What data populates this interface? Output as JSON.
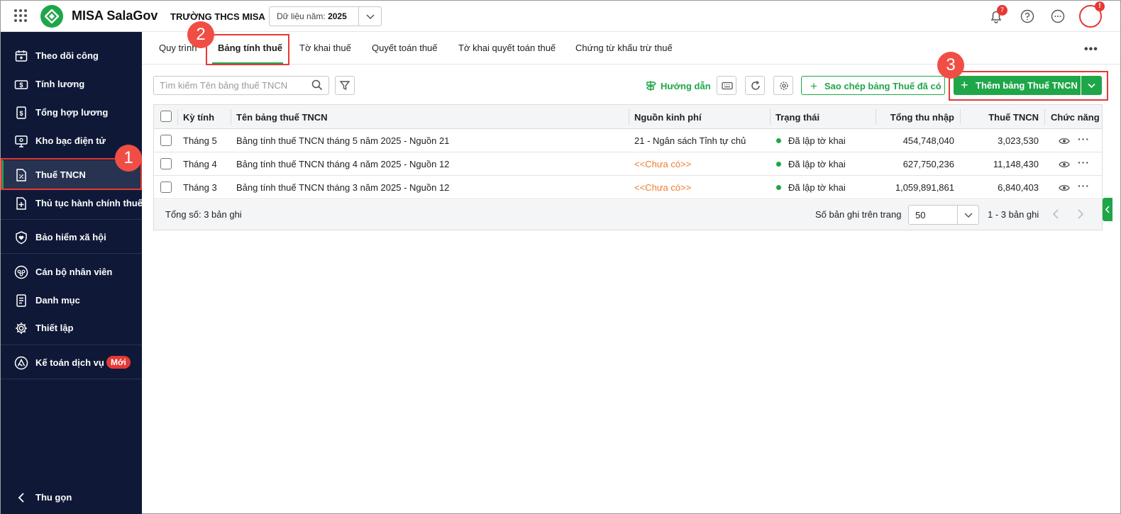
{
  "app": {
    "name": "MISA SalaGov",
    "org": "TRƯỜNG THCS MISA",
    "year_label": "Dữ liệu năm:",
    "year_value": "2025",
    "notification_count": "7",
    "avatar_alert": "!"
  },
  "sidebar": {
    "items": [
      {
        "label": "Theo dõi công",
        "icon": "calendar-icon"
      },
      {
        "label": "Tính lương",
        "icon": "money-icon"
      },
      {
        "label": "Tổng hợp lương",
        "icon": "salary-summary-icon"
      },
      {
        "label": "Kho bạc điện tử",
        "icon": "treasury-icon"
      },
      {
        "label": "Thuế TNCN",
        "icon": "tax-icon"
      },
      {
        "label": "Thủ tục hành chính thuế",
        "icon": "tax-procedure-icon"
      },
      {
        "label": "Bảo hiểm xã hội",
        "icon": "shield-heart-icon"
      },
      {
        "label": "Cán bộ nhân viên",
        "icon": "people-icon"
      },
      {
        "label": "Danh mục",
        "icon": "catalog-icon"
      },
      {
        "label": "Thiết lập",
        "icon": "gear-icon"
      },
      {
        "label": "Kế toán dịch vụ",
        "icon": "accounting-icon"
      }
    ],
    "new_badge": "Mới",
    "collapse_label": "Thu gọn"
  },
  "tabs": [
    "Quy trình",
    "Bảng tính thuế",
    "Tờ khai thuế",
    "Quyết toán thuế",
    "Tờ khai quyết toán thuế",
    "Chứng từ khấu trừ thuế"
  ],
  "toolbar": {
    "search_placeholder": "Tìm kiếm Tên bảng thuế TNCN",
    "guide_label": "Hướng dẫn",
    "copy_label": "Sao chép bảng Thuế đã có",
    "add_label": "Thêm bảng Thuế TNCN"
  },
  "table": {
    "columns": [
      "Kỳ tính",
      "Tên bảng thuế TNCN",
      "Nguồn kinh phí",
      "Trạng thái",
      "Tổng thu nhập",
      "Thuế TNCN",
      "Chức năng"
    ],
    "rows": [
      {
        "period": "Tháng 5",
        "name": "Bảng tính thuế TNCN tháng 5 năm 2025 - Nguồn 21",
        "source": "21 - Ngân sách Tỉnh tự chủ",
        "status": "Đã lập tờ khai",
        "income": "454,748,040",
        "tax": "3,023,530"
      },
      {
        "period": "Tháng 4",
        "name": "Bảng tính thuế TNCN tháng 4 năm 2025 - Nguồn 12",
        "source": "<<Chưa có>>",
        "status": "Đã lập tờ khai",
        "income": "627,750,236",
        "tax": "11,148,430"
      },
      {
        "period": "Tháng 3",
        "name": "Bảng tính thuế TNCN tháng 3 năm 2025 - Nguồn 12",
        "source": "<<Chưa có>>",
        "status": "Đã lập tờ khai",
        "income": "1,059,891,861",
        "tax": "6,840,403"
      }
    ],
    "total_label": "Tổng số: 3 bản ghi",
    "per_page_label": "Số bản ghi trên trang",
    "per_page_value": "50",
    "range_label": "1 - 3 bản ghi"
  },
  "markers": [
    "1",
    "2",
    "3"
  ],
  "colors": {
    "brand_green": "#1fa648",
    "sidebar_bg": "#0f1937",
    "alert_red": "#e53935",
    "warning_orange": "#f07b2e"
  }
}
